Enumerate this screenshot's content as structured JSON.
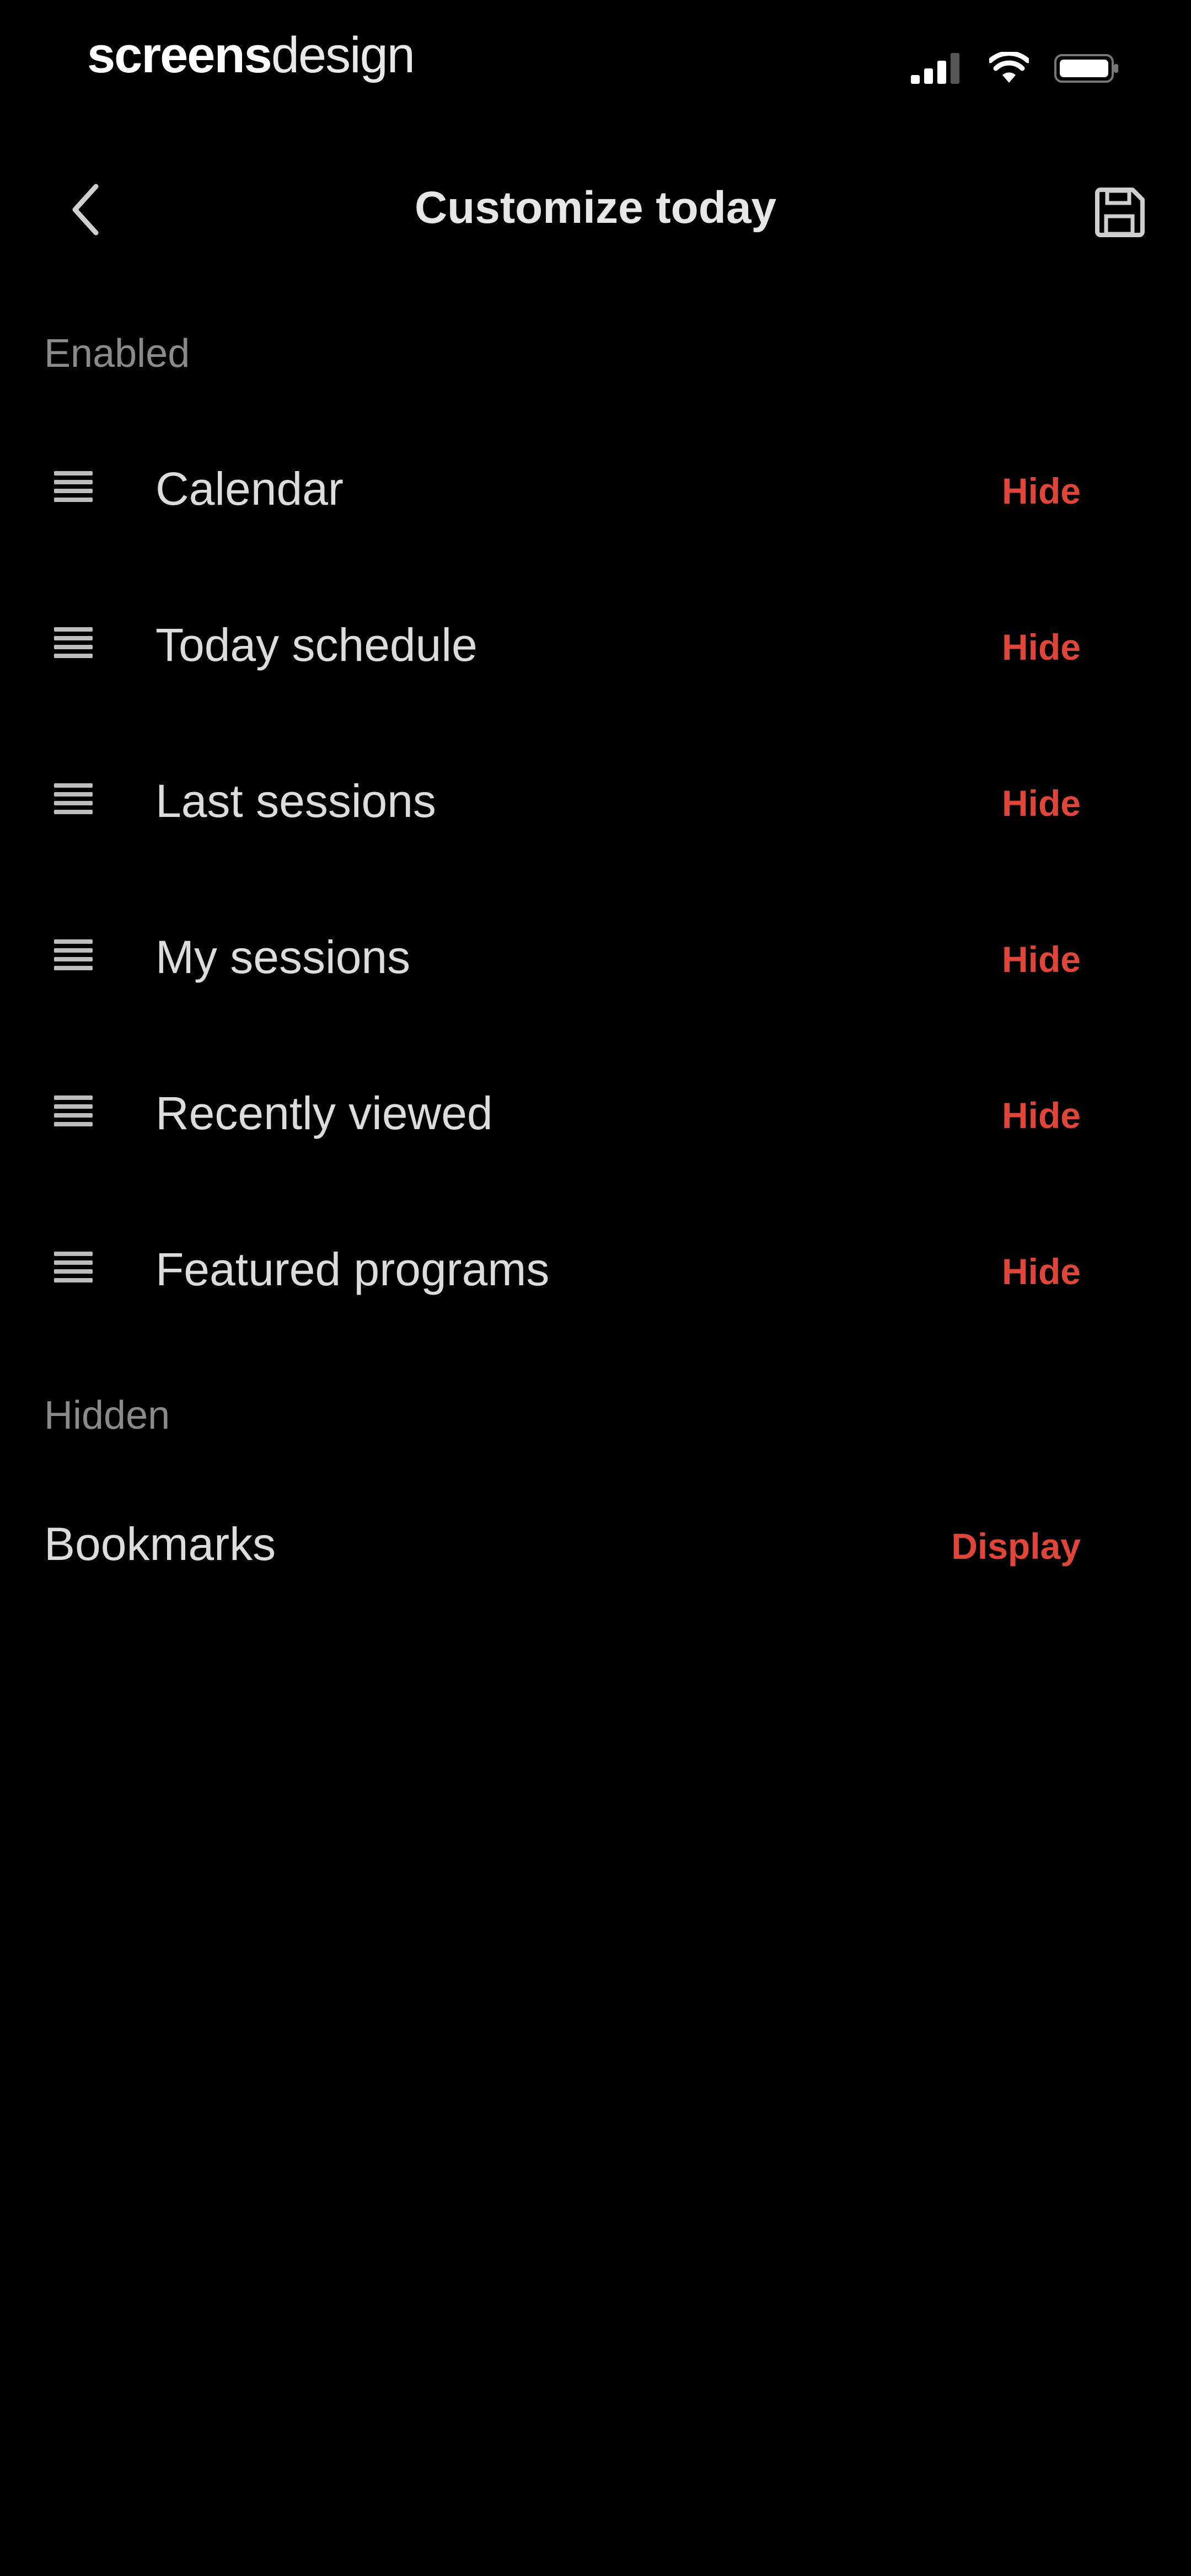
{
  "status_bar": {
    "brand_bold": "screens",
    "brand_light": "design",
    "icons": [
      "signal-icon",
      "wifi-icon",
      "battery-icon"
    ]
  },
  "nav": {
    "title": "Customize today",
    "back_icon": "chevron-left-icon",
    "save_icon": "save-icon"
  },
  "enabled": {
    "header": "Enabled",
    "items": [
      {
        "label": "Calendar",
        "action": "Hide"
      },
      {
        "label": "Today schedule",
        "action": "Hide"
      },
      {
        "label": "Last sessions",
        "action": "Hide"
      },
      {
        "label": "My sessions",
        "action": "Hide"
      },
      {
        "label": "Recently viewed",
        "action": "Hide"
      },
      {
        "label": "Featured programs",
        "action": "Hide"
      }
    ]
  },
  "hidden": {
    "header": "Hidden",
    "items": [
      {
        "label": "Bookmarks",
        "action": "Display"
      }
    ]
  },
  "colors": {
    "background": "#000000",
    "accent": "#e0453a",
    "text": "#dcdcdc",
    "muted": "#8a8a8a"
  }
}
